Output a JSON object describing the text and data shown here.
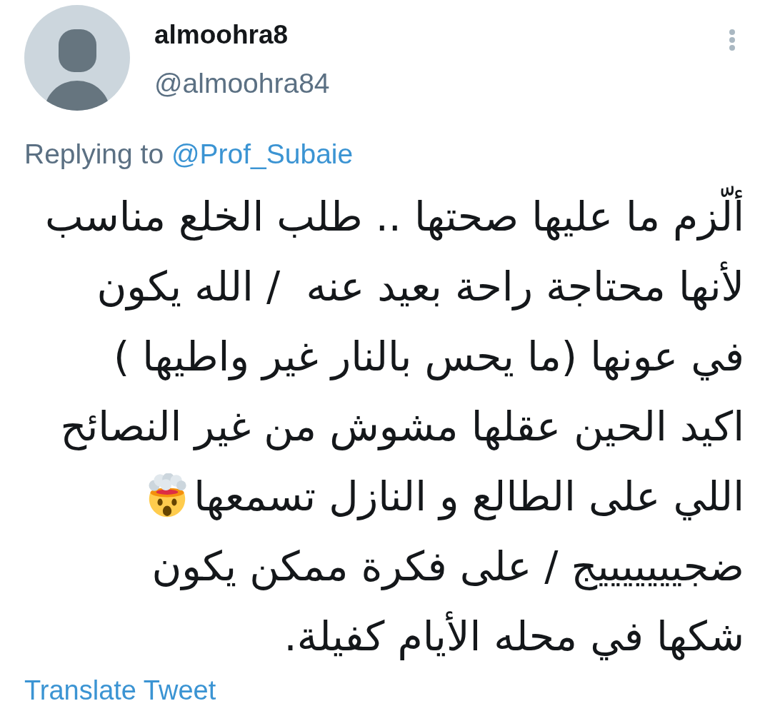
{
  "tweet": {
    "author": {
      "name": "almoohra8",
      "handle": "@almoohra84"
    },
    "reply": {
      "prefix": "Replying to",
      "mention": "@Prof_Subaie"
    },
    "body": {
      "lines": [
        {
          "kind": "text",
          "text": "ألّزم ما عليها صحتها .. طلب الخلع مناسب"
        },
        {
          "kind": "text",
          "text": "لأنها محتاجة راحة بعيد عنه  / الله يكون"
        },
        {
          "kind": "text",
          "text": "في عونها (ما يحس بالنار غير واطيها )"
        },
        {
          "kind": "text",
          "text": "اكيد الحين عقلها مشوش من غير النصائح"
        },
        {
          "kind": "text_emoji",
          "text": "اللي على الطالع و النازل تسمعها"
        },
        {
          "kind": "text",
          "text": "ضجيييييييج / على فكرة ممكن يكون"
        },
        {
          "kind": "text",
          "text": "شكها في محله الأيام كفيلة."
        }
      ]
    },
    "translate": "Translate Tweet"
  }
}
